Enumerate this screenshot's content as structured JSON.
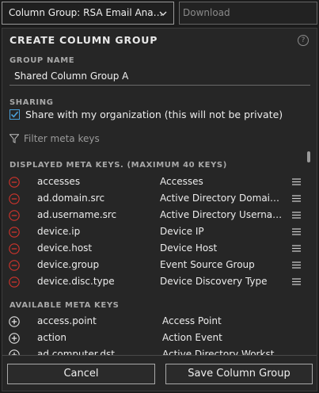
{
  "topbar": {
    "group_select_value": "Column Group: RSA Email Ana…",
    "download_placeholder": "Download"
  },
  "panel": {
    "title": "CREATE COLUMN GROUP",
    "help_icon": "question-circle-icon",
    "group_name_label": "GROUP NAME",
    "group_name_value": "Shared Column Group A",
    "sharing_label": "SHARING",
    "share_checkbox_checked": true,
    "share_text": "Share with my organization (this will not be private)",
    "filter_placeholder": "Filter meta keys",
    "displayed_label": "DISPLAYED META KEYS. (MAXIMUM 40 KEYS)",
    "displayed_keys": [
      {
        "key": "accesses",
        "desc": "Accesses"
      },
      {
        "key": "ad.domain.src",
        "desc": "Active Directory Domain So…"
      },
      {
        "key": "ad.username.src",
        "desc": "Active Directory Username …"
      },
      {
        "key": "device.ip",
        "desc": "Device IP"
      },
      {
        "key": "device.host",
        "desc": "Device Host"
      },
      {
        "key": "device.group",
        "desc": "Event Source Group"
      },
      {
        "key": "device.disc.type",
        "desc": "Device Discovery Type"
      }
    ],
    "available_label": "AVAILABLE META KEYS",
    "available_keys": [
      {
        "key": "access.point",
        "desc": "Access Point"
      },
      {
        "key": "action",
        "desc": "Action Event"
      },
      {
        "key": "ad.computer.dst",
        "desc": "Active Directory Workstatio…"
      }
    ],
    "cancel_label": "Cancel",
    "save_label": "Save Column Group"
  },
  "colors": {
    "remove_icon": "#d0342c",
    "checkbox": "#4a9fd8",
    "panel_bg": "#262626"
  }
}
